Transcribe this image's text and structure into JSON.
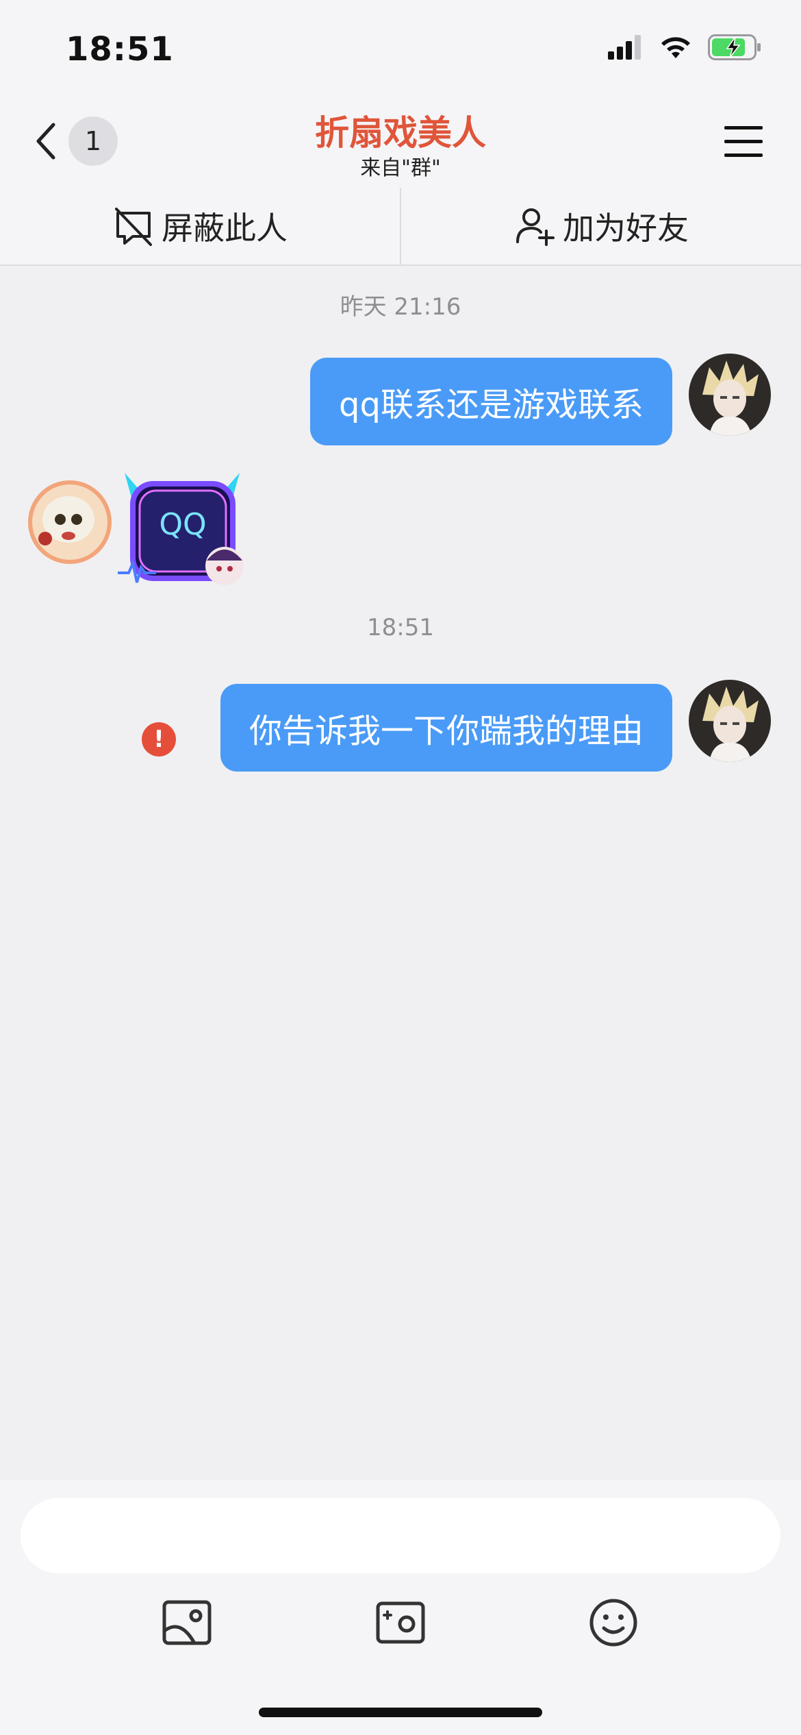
{
  "status_bar": {
    "time": "18:51"
  },
  "nav": {
    "back_count": "1",
    "title": "折扇戏美人",
    "subtitle": "来自\"群\""
  },
  "actions": {
    "block_label": "屏蔽此人",
    "add_friend_label": "加为好友"
  },
  "messages": [
    {
      "type": "timestamp",
      "text": "昨天 21:16"
    },
    {
      "type": "outgoing",
      "text": "qq联系还是游戏联系"
    },
    {
      "type": "incoming-sticker",
      "sticker_text": "QQ"
    },
    {
      "type": "timestamp",
      "text": "18:51"
    },
    {
      "type": "outgoing",
      "text": "你告诉我一下你踹我的理由",
      "status": "failed",
      "status_mark": "!"
    }
  ],
  "input": {
    "placeholder": ""
  },
  "colors": {
    "accent_title": "#e0553a",
    "bubble_out": "#4a9bf7",
    "error": "#e54f3a",
    "background": "#f0f0f2"
  },
  "icons": [
    "signal-icon",
    "wifi-icon",
    "battery-charging-icon",
    "chevron-left-icon",
    "hamburger-menu-icon",
    "block-icon",
    "add-user-icon",
    "image-icon",
    "camera-icon",
    "emoji-icon"
  ]
}
